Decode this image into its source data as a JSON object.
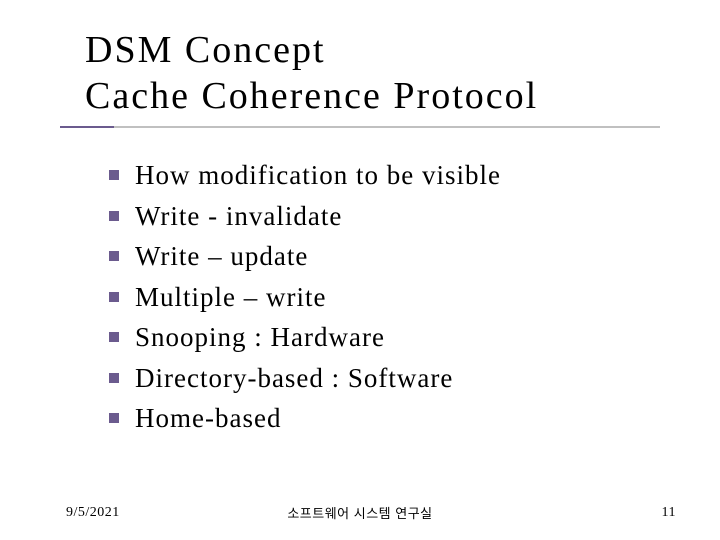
{
  "title": {
    "line1": "DSM Concept",
    "line2": "Cache Coherence Protocol"
  },
  "bullets": [
    "How modification to be visible",
    "Write - invalidate",
    "Write – update",
    "Multiple – write",
    "Snooping   : Hardware",
    "Directory-based : Software",
    "Home-based"
  ],
  "footer": {
    "date": "9/5/2021",
    "center": "소프트웨어 시스템 연구실",
    "page": "11"
  }
}
